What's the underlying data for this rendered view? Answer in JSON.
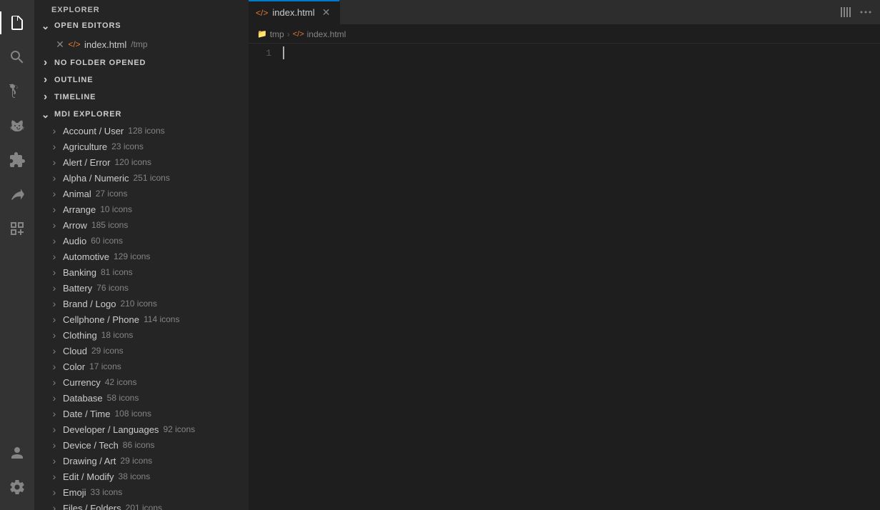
{
  "activityBar": {
    "items": [
      {
        "id": "explorer",
        "icon": "files-icon",
        "active": true
      },
      {
        "id": "search",
        "icon": "search-icon",
        "active": false
      },
      {
        "id": "source-control",
        "icon": "source-control-icon",
        "active": false
      },
      {
        "id": "run",
        "icon": "run-icon",
        "active": false
      },
      {
        "id": "extensions",
        "icon": "extensions-icon",
        "active": false
      },
      {
        "id": "remote",
        "icon": "remote-icon",
        "active": false
      },
      {
        "id": "mdi",
        "icon": "mdi-icon",
        "active": false
      }
    ],
    "bottomItems": [
      {
        "id": "account",
        "icon": "account-icon"
      },
      {
        "id": "settings",
        "icon": "settings-icon"
      }
    ]
  },
  "sidebar": {
    "title": "EXPLORER",
    "sections": {
      "openEditors": {
        "label": "OPEN EDITORS",
        "collapsed": false,
        "items": [
          {
            "filename": "index.html",
            "path": "/tmp",
            "modified": false
          }
        ]
      },
      "noFolder": {
        "label": "NO FOLDER OPENED",
        "collapsed": true
      },
      "outline": {
        "label": "OUTLINE",
        "collapsed": true
      },
      "timeline": {
        "label": "TIMELINE",
        "collapsed": true
      },
      "mdiExplorer": {
        "label": "MDI EXPLORER",
        "collapsed": false,
        "items": [
          {
            "name": "Account / User",
            "count": "128 icons"
          },
          {
            "name": "Agriculture",
            "count": "23 icons"
          },
          {
            "name": "Alert / Error",
            "count": "120 icons"
          },
          {
            "name": "Alpha / Numeric",
            "count": "251 icons"
          },
          {
            "name": "Animal",
            "count": "27 icons"
          },
          {
            "name": "Arrange",
            "count": "10 icons"
          },
          {
            "name": "Arrow",
            "count": "185 icons"
          },
          {
            "name": "Audio",
            "count": "60 icons"
          },
          {
            "name": "Automotive",
            "count": "129 icons"
          },
          {
            "name": "Banking",
            "count": "81 icons"
          },
          {
            "name": "Battery",
            "count": "76 icons"
          },
          {
            "name": "Brand / Logo",
            "count": "210 icons"
          },
          {
            "name": "Cellphone / Phone",
            "count": "114 icons"
          },
          {
            "name": "Clothing",
            "count": "18 icons"
          },
          {
            "name": "Cloud",
            "count": "29 icons"
          },
          {
            "name": "Color",
            "count": "17 icons"
          },
          {
            "name": "Currency",
            "count": "42 icons"
          },
          {
            "name": "Database",
            "count": "58 icons"
          },
          {
            "name": "Date / Time",
            "count": "108 icons"
          },
          {
            "name": "Developer / Languages",
            "count": "92 icons"
          },
          {
            "name": "Device / Tech",
            "count": "86 icons"
          },
          {
            "name": "Drawing / Art",
            "count": "29 icons"
          },
          {
            "name": "Edit / Modify",
            "count": "38 icons"
          },
          {
            "name": "Emoji",
            "count": "33 icons"
          },
          {
            "name": "Files / Folders",
            "count": "201 icons"
          }
        ]
      }
    }
  },
  "editor": {
    "tabs": [
      {
        "label": "index.html",
        "active": true,
        "icon": "html-icon"
      }
    ],
    "breadcrumb": {
      "parts": [
        "tmp",
        "index.html"
      ]
    },
    "lineNumbers": [
      "1"
    ],
    "content": ""
  }
}
